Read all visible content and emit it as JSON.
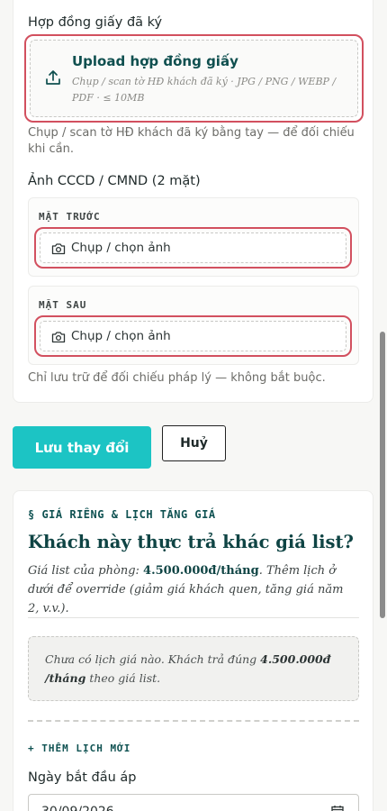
{
  "contract": {
    "label": "Hợp đồng giấy đã ký",
    "upload_title": "Upload hợp đồng giấy",
    "upload_hint": "Chụp / scan tờ HĐ khách đã ký · JPG / PNG / WEBP / PDF · ≤ 10MB",
    "help": "Chụp / scan tờ HĐ khách đã ký bằng tay — để đối chiếu khi cần."
  },
  "id_card": {
    "label": "Ảnh CCCD / CMND (2 mặt)",
    "front_label": "MẶT TRƯỚC",
    "back_label": "MẶT SAU",
    "capture_label": "Chụp / chọn ảnh",
    "help": "Chỉ lưu trữ để đối chiếu pháp lý — không bắt buộc."
  },
  "actions": {
    "save_label": "Lưu thay đổi",
    "cancel_label": "Huỷ"
  },
  "pricing": {
    "tag": "§ GIÁ RIÊNG & LỊCH TĂNG GIÁ",
    "title": "Khách này thực trả khác giá list?",
    "desc_prefix": "Giá list của phòng: ",
    "list_price": "4.500.000đ/tháng",
    "desc_suffix": ". Thêm lịch ở dưới để override (giảm giá khách quen, tăng giá năm 2, v.v.).",
    "empty_prefix": "Chưa có lịch giá nào. Khách trả đúng ",
    "empty_price": "4.500.000đ /tháng",
    "empty_suffix": " theo giá list.",
    "add_tag": "+ THÊM LỊCH MỚI",
    "start_date_label": "Ngày bắt đầu áp",
    "start_date_value": "30/09/2026"
  },
  "colors": {
    "accent": "#1cc4c4",
    "highlight_outline": "#d2505f",
    "heading": "#0f4444"
  }
}
